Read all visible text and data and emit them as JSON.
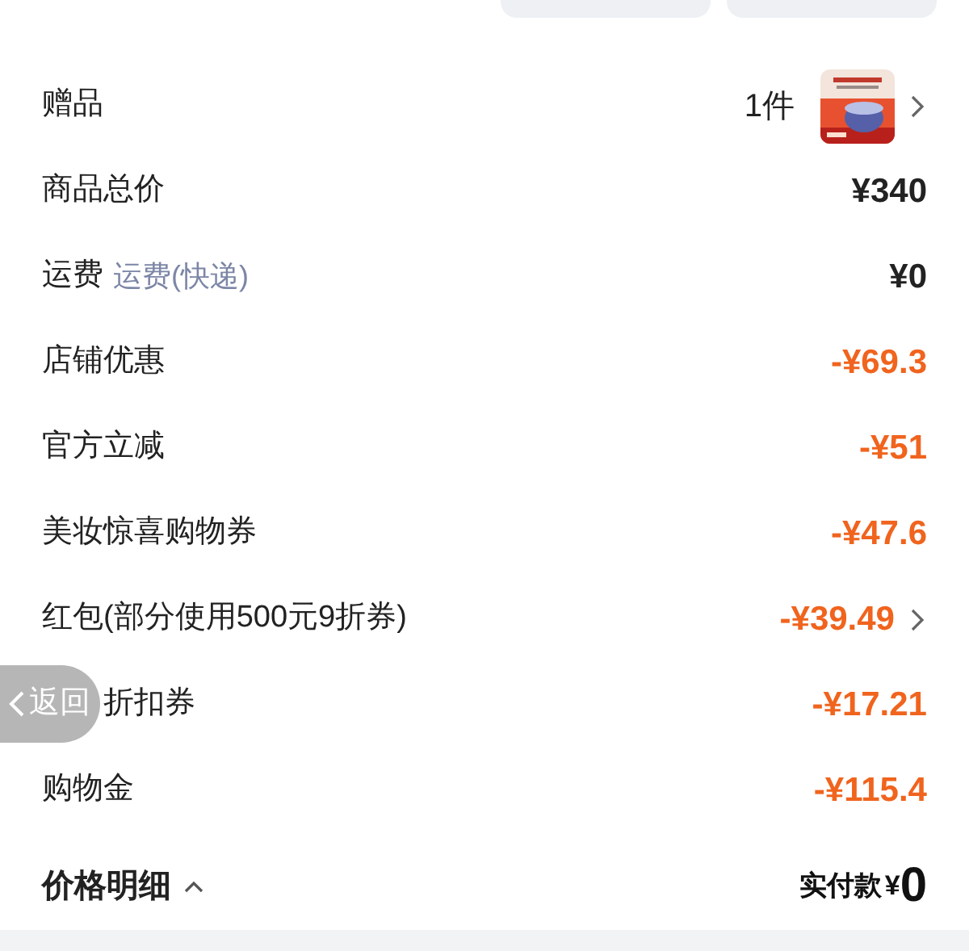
{
  "rows": [
    {
      "kind": "gift",
      "label": "赠品",
      "value": "1件",
      "chevron": true
    },
    {
      "kind": "plain",
      "label": "商品总价",
      "value": "¥340",
      "chevron": false
    },
    {
      "kind": "shipping",
      "label": "运费",
      "note": "运费(快递)",
      "value": "¥0",
      "chevron": false
    },
    {
      "kind": "discount",
      "label": "店铺优惠",
      "value": "-¥69.3",
      "chevron": false
    },
    {
      "kind": "discount",
      "label": "官方立减",
      "value": "-¥51",
      "chevron": false
    },
    {
      "kind": "discount",
      "label": "美妆惊喜购物券",
      "value": "-¥47.6",
      "chevron": false
    },
    {
      "kind": "discount",
      "label": "红包(部分使用500元9折券)",
      "value": "-¥39.49",
      "chevron": true
    },
    {
      "kind": "discount",
      "label": "折扣券",
      "value": "-¥17.21",
      "chevron": false,
      "under_back_button": true
    },
    {
      "kind": "discount",
      "label": "购物金",
      "value": "-¥115.4",
      "chevron": false
    }
  ],
  "back_button": {
    "label": "返回"
  },
  "footer": {
    "label": "价格明细",
    "expanded": true,
    "total_label": "实付款",
    "currency": "¥",
    "total": "0"
  }
}
